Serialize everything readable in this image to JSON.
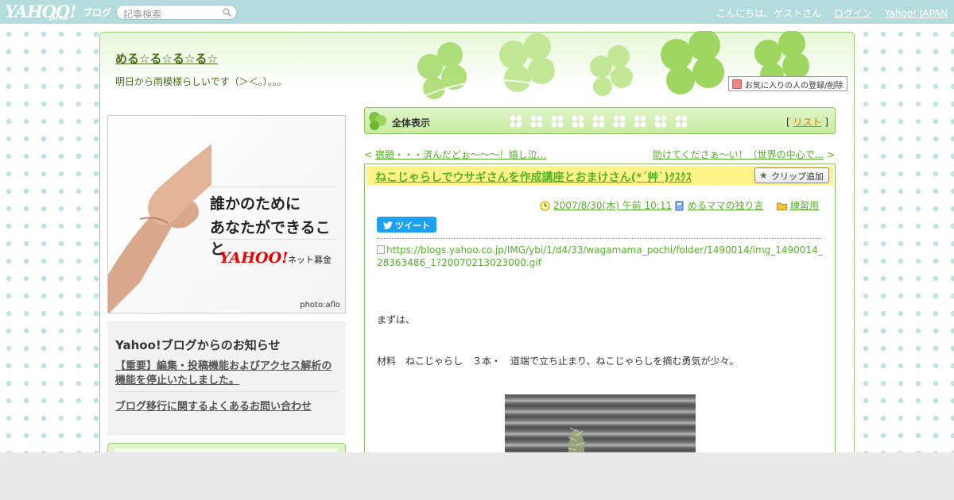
{
  "topbar": {
    "logo_text": "YAHOO!",
    "logo_sub": "JAPAN",
    "logo_blog": "ブログ",
    "search_placeholder": "記事検索",
    "greeting": "こんにちは、ゲストさん",
    "login_label": "ログイン",
    "yahoo_japan_label": "Yahoo! JAPAN"
  },
  "header": {
    "blog_title": "める☆る☆る☆る☆",
    "blog_description": "明日から雨模様らしいです（＞＜。）。。。",
    "favorite_button": "お気に入りの人の登録/削除"
  },
  "ad": {
    "line1": "誰かのために",
    "line2": "あなたができること",
    "brand": "YAHOO!",
    "brand_sub": "ネット募金",
    "credit": "photo:aflo"
  },
  "notice": {
    "title": "Yahoo!ブログからのお知らせ",
    "item1": "【重要】編集・投稿機能およびアクセス解析の機能を停止いたしました。",
    "item2": "ブログ移行に関するよくあるお問い合わせ"
  },
  "category_bar": {
    "label": "全体表示",
    "list_open": "[",
    "list_label": "リスト",
    "list_close": "]"
  },
  "nav": {
    "prev_arrow": "<",
    "prev_label": "宿題・・・済んだどぉ～～～！嬉し泣...",
    "next_label": "助けてくださぁ～い！（世界の中心で...",
    "next_arrow": ">"
  },
  "article": {
    "title": "ねこじゃらしでウサギさんを作成講座とおまけさん(*´艸`)ｸｽｸｽ",
    "clip_button": "クリップ追加",
    "date": "2007/8/30(木) 午前 10:11",
    "author_category": "めるママの独り言",
    "folder": "練習用",
    "tweet_button": "ツイート",
    "image_url": "https://blogs.yahoo.co.jp/IMG/ybi/1/d4/33/wagamama_pochi/folder/1490014/img_1490014_28363486_1?20070213023000.gif",
    "paragraph1": "まずは、",
    "paragraph2": "材料　ねこじゃらし　３本・　道端で立ち止まり、ねこじゃらしを摘む勇気が少々。"
  },
  "colors": {
    "accent_green": "#55b22a",
    "topbar": "#b5dcdc",
    "title_bg": "#fff38a"
  }
}
